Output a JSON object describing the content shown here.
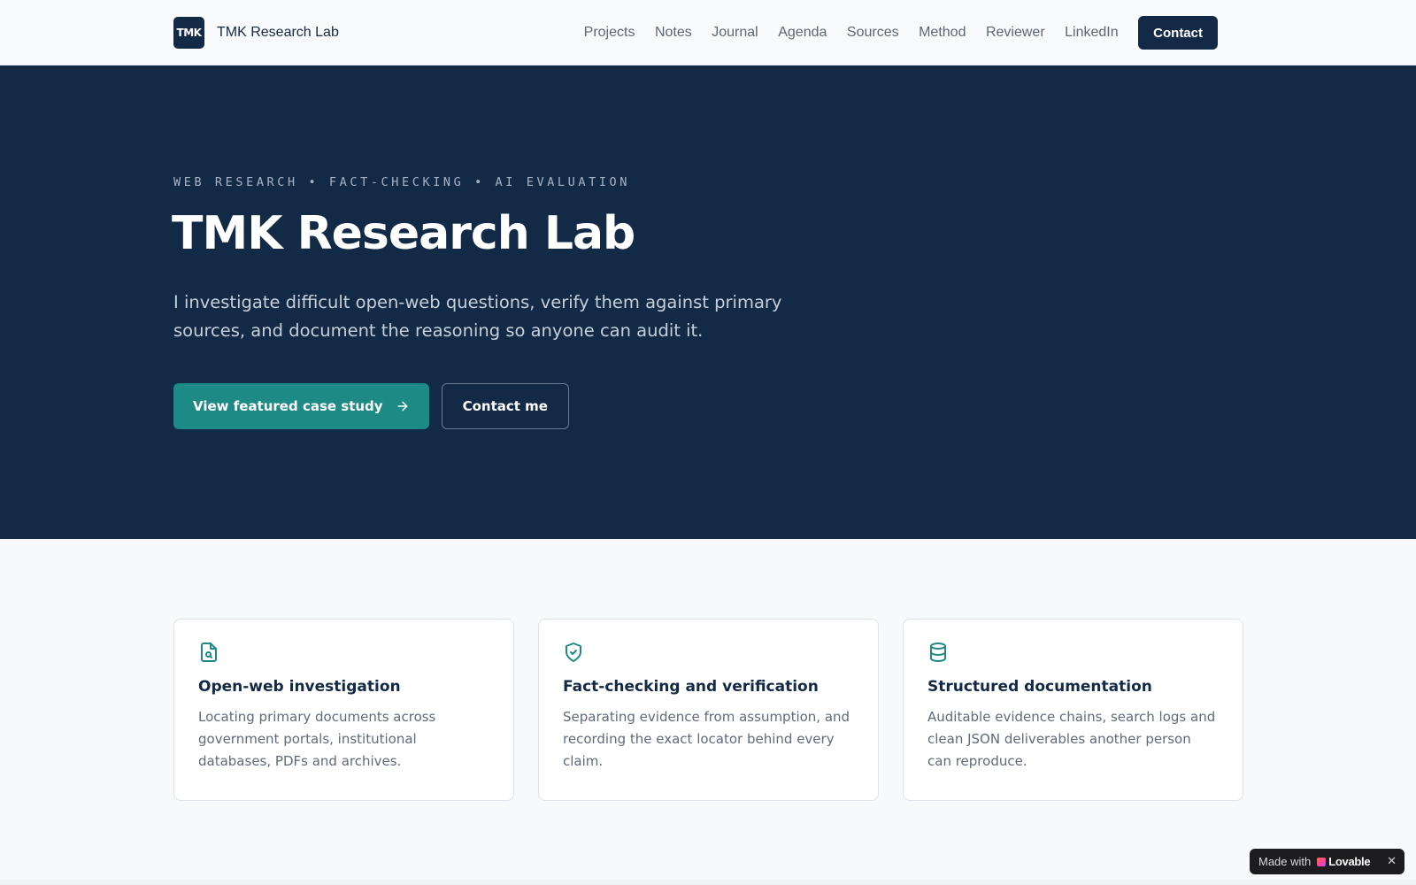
{
  "header": {
    "logo_text": "TMK",
    "brand_name": "TMK Research Lab",
    "nav": [
      "Projects",
      "Notes",
      "Journal",
      "Agenda",
      "Sources",
      "Method",
      "Reviewer",
      "LinkedIn"
    ],
    "contact_label": "Contact"
  },
  "hero": {
    "eyebrow": "WEB RESEARCH • FACT-CHECKING • AI EVALUATION",
    "title": "TMK Research Lab",
    "subtitle": "I investigate difficult open-web questions, verify them against primary sources, and document the reasoning so anyone can audit it.",
    "primary_cta": "View featured case study",
    "secondary_cta": "Contact me"
  },
  "features": [
    {
      "icon": "file-search-icon",
      "title": "Open-web investigation",
      "description": "Locating primary documents across government portals, institutional databases, PDFs and archives."
    },
    {
      "icon": "shield-check-icon",
      "title": "Fact-checking and verification",
      "description": "Separating evidence from assumption, and recording the exact locator behind every claim."
    },
    {
      "icon": "database-icon",
      "title": "Structured documentation",
      "description": "Auditable evidence chains, search logs and clean JSON deliverables another person can reproduce."
    }
  ],
  "badge": {
    "prefix": "Made with",
    "brand": "Lovable",
    "close": "✕"
  },
  "colors": {
    "navy": "#132a47",
    "teal": "#1e8a86",
    "page_bg": "#f7f9fb"
  }
}
